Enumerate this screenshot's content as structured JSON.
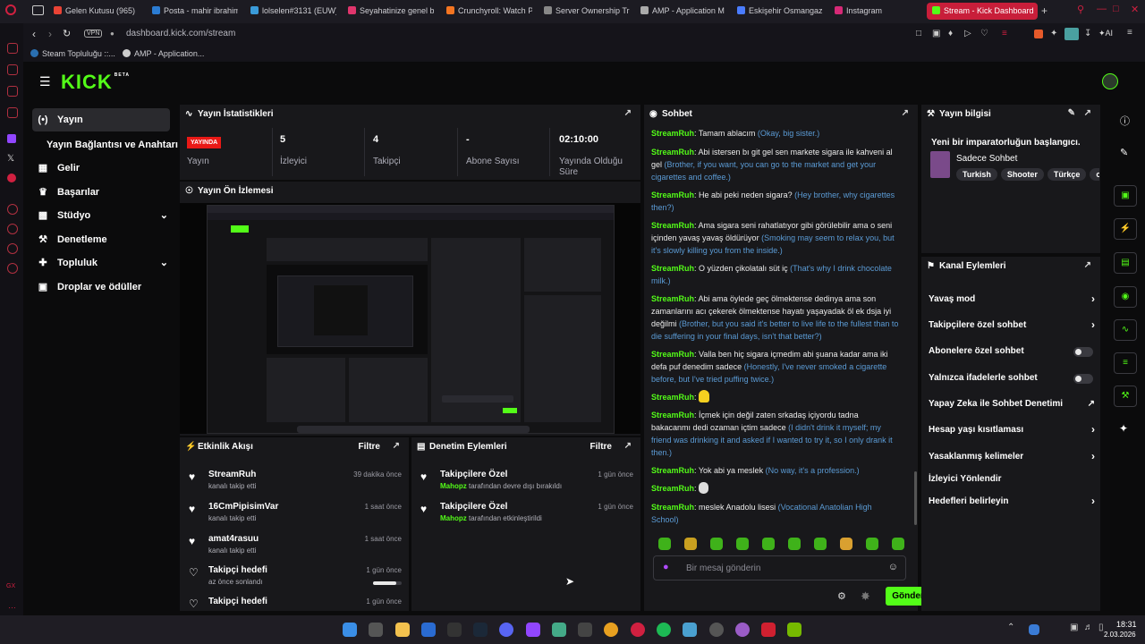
{
  "browser": {
    "tabs": [
      "Gelen Kutusu (965)",
      "Posta - mahir ibrahim",
      "lolselen#3131 (EUW)",
      "Seyahatinize genel b",
      "Crunchyroll: Watch P",
      "Server Ownership Tr",
      "AMP - Application M",
      "Eskişehir Osmangazi",
      "Instagram",
      "Stream - Kick Dashboard"
    ],
    "vpn": "VPN",
    "url": "dashboard.kick.com/stream",
    "ai_label": "AI",
    "bookmarks": [
      "Steam Topluluğu ::...",
      "AMP - Application..."
    ]
  },
  "kick": {
    "logo": "KICK",
    "logo_badge": "BETA",
    "nav": [
      {
        "label": "Yayın",
        "icon": "broadcast-icon"
      },
      {
        "label": "Yayın Bağlantısı ve Anahtarı",
        "icon": ""
      },
      {
        "label": "Gelir",
        "icon": "chart-icon"
      },
      {
        "label": "Başarılar",
        "icon": "trophy-icon"
      },
      {
        "label": "Stüdyo",
        "icon": "studio-icon"
      },
      {
        "label": "Denetleme",
        "icon": "wrench-icon"
      },
      {
        "label": "Topluluk",
        "icon": "community-icon"
      },
      {
        "label": "Droplar ve ödüller",
        "icon": "gift-icon"
      }
    ],
    "stats": {
      "title": "Yayın İstatistikleri",
      "live_badge": "YAYINDA",
      "items": [
        {
          "value": "",
          "label": "Yayın"
        },
        {
          "value": "5",
          "label": "İzleyici"
        },
        {
          "value": "4",
          "label": "Takipçi"
        },
        {
          "value": "-",
          "label": "Abone Sayısı"
        },
        {
          "value": "02:10:00",
          "label": "Yayında Olduğu Süre"
        }
      ]
    },
    "preview": {
      "title": "Yayın Ön İzlemesi"
    },
    "activity": {
      "title": "Etkinlik Akışı",
      "filter": "Filtre",
      "items": [
        {
          "name": "StreamRuh",
          "sub": "kanalı takip etti",
          "time": "39 dakika önce",
          "icon": "heart-icon"
        },
        {
          "name": "16CmPipisimVar",
          "sub": "kanalı takip etti",
          "time": "1 saat önce",
          "icon": "heart-icon"
        },
        {
          "name": "amat4rasuu",
          "sub": "kanalı takip etti",
          "time": "1 saat önce",
          "icon": "heart-icon"
        },
        {
          "name": "Takipçi hedefi",
          "sub": "az önce sonlandı",
          "time": "1 gün önce",
          "icon": "heart-outline-icon",
          "progress": 0.8
        },
        {
          "name": "Takipçi hedefi",
          "sub": "",
          "time": "1 gün önce",
          "icon": "heart-outline-icon"
        }
      ]
    },
    "moderation": {
      "title": "Denetim Eylemleri",
      "filter": "Filtre",
      "items": [
        {
          "name": "Takipçilere Özel",
          "user": "Mahopz",
          "sub": "tarafından devre dışı bırakıldı",
          "time": "1 gün önce"
        },
        {
          "name": "Takipçilere Özel",
          "user": "Mahopz",
          "sub": "tarafından etkinleştirildi",
          "time": "1 gün önce"
        }
      ]
    },
    "chat": {
      "title": "Sohbet",
      "messages": [
        {
          "user": "StreamRuh",
          "text": "Tamam ablacım",
          "tr": "(Okay, big sister.)"
        },
        {
          "user": "StreamRuh",
          "text": "Abi istersen bı git gel sen markete sigara ile kahveni al gel",
          "tr": "(Brother, if you want, you can go to the market and get your cigarettes and coffee.)"
        },
        {
          "user": "StreamRuh",
          "text": "He abi peki neden sigara?",
          "tr": "(Hey brother, why cigarettes then?)"
        },
        {
          "user": "StreamRuh",
          "text": "Ama sigara seni rahatlatıyor gibi görülebilir ama o seni içinden yavaş yavaş öldürüyor",
          "tr": "(Smoking may seem to relax you, but it's slowly killing you from the inside.)"
        },
        {
          "user": "StreamRuh",
          "text": "O yüzden çikolatalı süt iç",
          "tr": "(That's why I drink chocolate milk.)"
        },
        {
          "user": "StreamRuh",
          "text": "Abi ama öylede geç ölmektense dedinya ama son zamanlarını acı çekerek ölmektense hayatı yaşayadak öl ek dsja iyi değilmi",
          "tr": "(Brother, but you said it's better to live life to the fullest than to die suffering in your final days, isn't that better?)"
        },
        {
          "user": "StreamRuh",
          "text": "Valla ben hiç sigara içmedim abi şuana kadar ama iki defa puf denedim sadece",
          "tr": "(Honestly, I've never smoked a cigarette before, but I've tried puffing twice.)"
        },
        {
          "user": "StreamRuh",
          "text": "",
          "tr": ""
        },
        {
          "user": "StreamRuh",
          "text": "İçmek için değil zaten srkadaş içiyordu tadna bakacanmı dedi ozaman içtim sadece",
          "tr": "(I didn't drink it myself; my friend was drinking it and asked if I wanted to try it, so I only drank it then.)"
        },
        {
          "user": "StreamRuh",
          "text": "Yok abi ya meslek",
          "tr": "(No way, it's a profession.)"
        },
        {
          "user": "StreamRuh",
          "text": "",
          "tr": ""
        },
        {
          "user": "StreamRuh",
          "text": "meslek Anadolu lisesi",
          "tr": "(Vocational Anatolian High School)"
        }
      ],
      "placeholder": "Bir mesaj gönderin",
      "send": "Gönder"
    },
    "stream_info": {
      "title": "Yayın bilgisi",
      "stream_title": "Yeni bir imparatorluğun başlangıcı.",
      "category": "Sadece Sohbet",
      "tags": [
        "Turkish",
        "Shooter",
        "Türkçe",
        "o"
      ]
    },
    "channel_actions": {
      "title": "Kanal Eylemleri",
      "items": [
        {
          "label": "Yavaş mod",
          "type": "arrow"
        },
        {
          "label": "Takipçilere özel sohbet",
          "type": "arrow"
        },
        {
          "label": "Abonelere özel sohbet",
          "type": "toggle",
          "on": false
        },
        {
          "label": "Yalnızca ifadelerle sohbet",
          "type": "toggle",
          "on": false
        },
        {
          "label": "Yapay Zeka ile Sohbet Denetimi",
          "type": "external"
        },
        {
          "label": "Hesap yaşı kısıtlaması",
          "type": "arrow"
        },
        {
          "label": "Yasaklanmış kelimeler",
          "type": "arrow"
        },
        {
          "label": "İzleyici Yönlendir",
          "type": "none"
        },
        {
          "label": "Hedefleri belirleyin",
          "type": "arrow"
        }
      ]
    }
  },
  "taskbar": {
    "time": "18:31",
    "date": "2.03.2026"
  },
  "colors": {
    "accent": "#53fc18",
    "live": "#e91916",
    "panel": "#18181b",
    "translation": "#5b9bd5"
  }
}
